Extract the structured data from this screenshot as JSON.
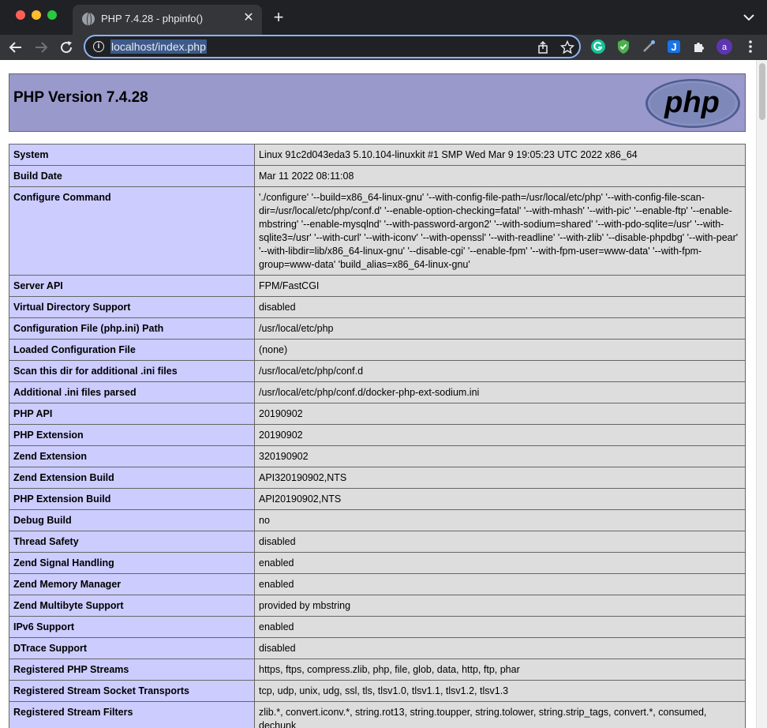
{
  "browser": {
    "tab_title": "PHP 7.4.28 - phpinfo()",
    "url": "localhost/index.php",
    "avatar_letter": "a"
  },
  "page": {
    "title": "PHP Version 7.4.28",
    "logo_text": "php"
  },
  "rows": [
    {
      "label": "System",
      "value": "Linux 91c2d043eda3 5.10.104-linuxkit #1 SMP Wed Mar 9 19:05:23 UTC 2022 x86_64"
    },
    {
      "label": "Build Date",
      "value": "Mar 11 2022 08:11:08"
    },
    {
      "label": "Configure Command",
      "value": "'./configure' '--build=x86_64-linux-gnu' '--with-config-file-path=/usr/local/etc/php' '--with-config-file-scan-dir=/usr/local/etc/php/conf.d' '--enable-option-checking=fatal' '--with-mhash' '--with-pic' '--enable-ftp' '--enable-mbstring' '--enable-mysqlnd' '--with-password-argon2' '--with-sodium=shared' '--with-pdo-sqlite=/usr' '--with-sqlite3=/usr' '--with-curl' '--with-iconv' '--with-openssl' '--with-readline' '--with-zlib' '--disable-phpdbg' '--with-pear' '--with-libdir=lib/x86_64-linux-gnu' '--disable-cgi' '--enable-fpm' '--with-fpm-user=www-data' '--with-fpm-group=www-data' 'build_alias=x86_64-linux-gnu'"
    },
    {
      "label": "Server API",
      "value": "FPM/FastCGI"
    },
    {
      "label": "Virtual Directory Support",
      "value": "disabled"
    },
    {
      "label": "Configuration File (php.ini) Path",
      "value": "/usr/local/etc/php"
    },
    {
      "label": "Loaded Configuration File",
      "value": "(none)"
    },
    {
      "label": "Scan this dir for additional .ini files",
      "value": "/usr/local/etc/php/conf.d"
    },
    {
      "label": "Additional .ini files parsed",
      "value": "/usr/local/etc/php/conf.d/docker-php-ext-sodium.ini"
    },
    {
      "label": "PHP API",
      "value": "20190902"
    },
    {
      "label": "PHP Extension",
      "value": "20190902"
    },
    {
      "label": "Zend Extension",
      "value": "320190902"
    },
    {
      "label": "Zend Extension Build",
      "value": "API320190902,NTS"
    },
    {
      "label": "PHP Extension Build",
      "value": "API20190902,NTS"
    },
    {
      "label": "Debug Build",
      "value": "no"
    },
    {
      "label": "Thread Safety",
      "value": "disabled"
    },
    {
      "label": "Zend Signal Handling",
      "value": "enabled"
    },
    {
      "label": "Zend Memory Manager",
      "value": "enabled"
    },
    {
      "label": "Zend Multibyte Support",
      "value": "provided by mbstring"
    },
    {
      "label": "IPv6 Support",
      "value": "enabled"
    },
    {
      "label": "DTrace Support",
      "value": "disabled"
    },
    {
      "label": "Registered PHP Streams",
      "value": "https, ftps, compress.zlib, php, file, glob, data, http, ftp, phar"
    },
    {
      "label": "Registered Stream Socket Transports",
      "value": "tcp, udp, unix, udg, ssl, tls, tlsv1.0, tlsv1.1, tlsv1.2, tlsv1.3"
    },
    {
      "label": "Registered Stream Filters",
      "value": "zlib.*, convert.iconv.*, string.rot13, string.toupper, string.tolower, string.strip_tags, convert.*, consumed, dechunk"
    }
  ],
  "colors": {
    "header_bg": "#9999cc",
    "label_bg": "#ccccff",
    "value_bg": "#dddddd",
    "url_border": "#8ab4f8"
  }
}
